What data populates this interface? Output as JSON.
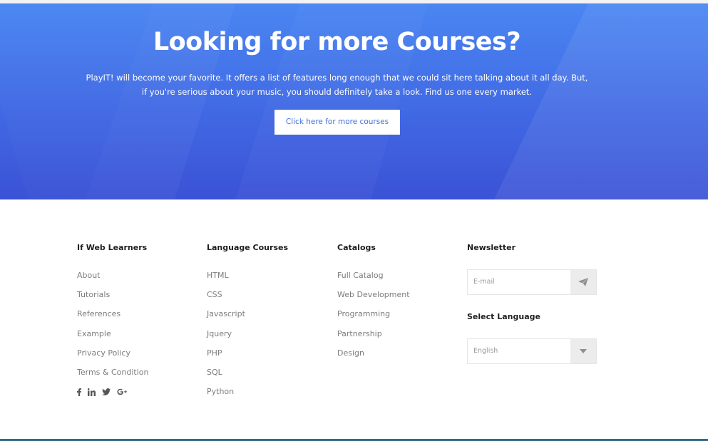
{
  "hero": {
    "title": "Looking for more Courses?",
    "text": "PlayIT! will become your favorite. It offers a list of features long enough that we could sit here talking about it all day. But, if you're serious about your music, you should definitely take a look. Find us one every market.",
    "button_label": "Click here for more courses"
  },
  "footer": {
    "col1": {
      "title": "If Web Learners",
      "items": [
        "About",
        "Tutorials",
        "References",
        "Example",
        "Privacy Policy",
        "Terms & Condition"
      ]
    },
    "col2": {
      "title": "Language Courses",
      "items": [
        "HTML",
        "CSS",
        "Javascript",
        "Jquery",
        "PHP",
        "SQL",
        "Python"
      ]
    },
    "col3": {
      "title": "Catalogs",
      "items": [
        "Full Catalog",
        "Web Development",
        "Programming",
        "Partnership",
        "Design"
      ]
    },
    "newsletter": {
      "title": "Newsletter",
      "email_placeholder": "E-mail",
      "send_icon": "paper-plane-icon"
    },
    "language": {
      "title": "Select Language",
      "selected": "English"
    },
    "social_icons": [
      "facebook-icon",
      "linkedin-icon",
      "twitter-icon",
      "google-plus-icon"
    ]
  },
  "colors": {
    "hero_gradient_top": "#4a86f2",
    "hero_gradient_bottom": "#3b52d6",
    "button_text": "#3f6fdf",
    "link_gray": "#7c7c7c"
  }
}
